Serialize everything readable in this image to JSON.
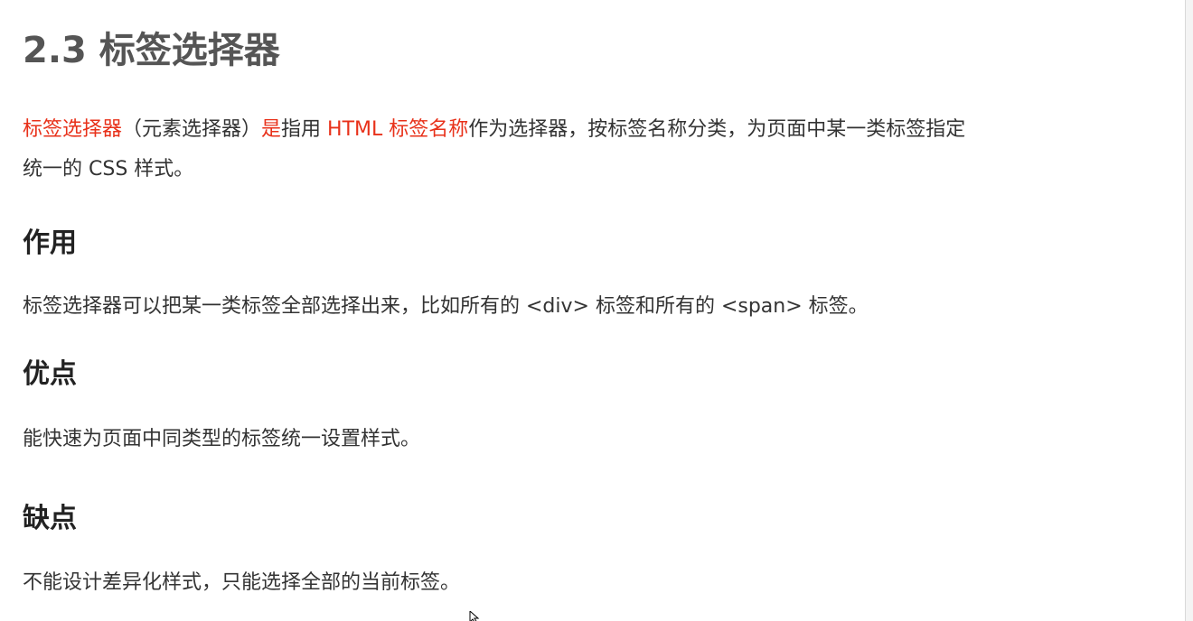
{
  "title": "2.3 标签选择器",
  "intro": {
    "line1": {
      "s1": "标签选择器",
      "s2": "（元素选择器）",
      "s3": "是",
      "s4": "指用 ",
      "s5": "HTML 标签名称",
      "s6": "作为选择器，按标签名称分类，为页面中某一类标签指定"
    },
    "line2": "统一的 CSS 样式。"
  },
  "sections": [
    {
      "heading": "作用",
      "text": "标签选择器可以把某一类标签全部选择出来，比如所有的 <div> 标签和所有的 <span> 标签。"
    },
    {
      "heading": "优点",
      "text": "能快速为页面中同类型的标签统一设置样式。"
    },
    {
      "heading": "缺点",
      "text": "不能设计差异化样式，只能选择全部的当前标签。"
    }
  ],
  "colors": {
    "accent_red": "#e8311a",
    "title_gray": "#555555",
    "text": "#333333"
  },
  "icons": {
    "cursor": "mouse-cursor-icon"
  }
}
